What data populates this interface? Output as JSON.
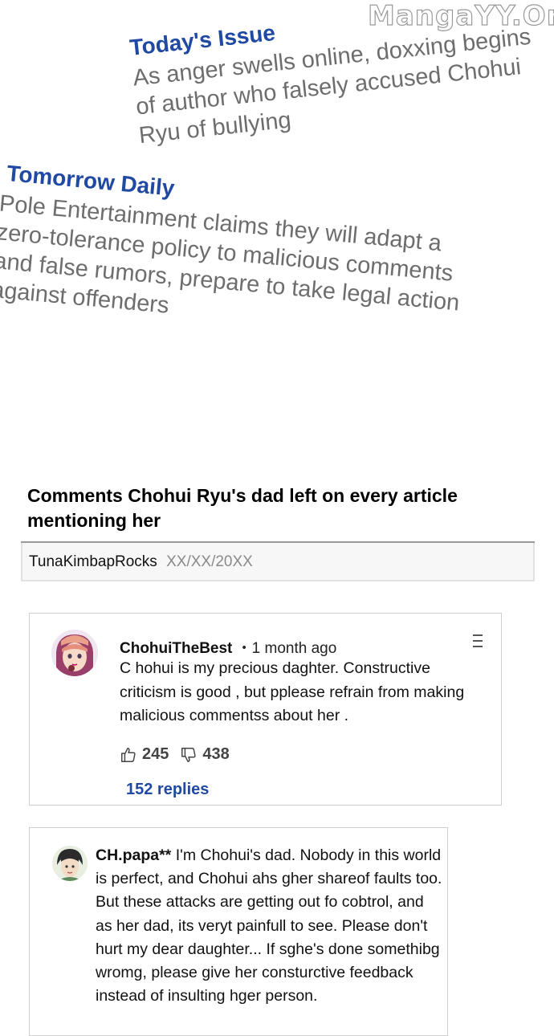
{
  "watermark": "MangaYY.Org",
  "news": [
    {
      "source": "Today's Issue",
      "headline": "As anger swells online, doxxing begins of author who falsely accused Chohui Ryu of bullying"
    },
    {
      "source": "Tomorrow Daily",
      "headline": "Pole Entertainment claims they will adapt a zero-tolerance policy to malicious comments and false rumors, prepare to  take legal action against offenders"
    }
  ],
  "article": {
    "title": "Comments Chohui Ryu's dad left on every article mentioning her",
    "author": "TunaKimbapRocks",
    "date": "XX/XX/20XX"
  },
  "comments": [
    {
      "username": "ChohuiTheBest",
      "time": "・1 month ago",
      "text": "C hohui is my precious daghter. Constructive criticism is good , but pplease refrain from making malicious commentss about her .",
      "likes": "245",
      "dislikes": "438",
      "replies": "152 replies",
      "menu_icon": "more-menu-icon"
    },
    {
      "username": "CH.papa**",
      "text": " I'm Chohui's dad. Nobody in this world is perfect, and Chohui ahs gher shareof faults too. But these attacks are getting out fo cobtrol, and as her dad, its veryt painfull to see. Please don't hurt my dear daughter... If sghe's done somethibg wromg, please give her consturctive feedback instead of insulting hger person."
    }
  ],
  "colors": {
    "news_source": "#1f49a3",
    "news_body": "#6d6d6d",
    "replies_link": "#1f49a3",
    "card_border": "#cfcfcf"
  }
}
